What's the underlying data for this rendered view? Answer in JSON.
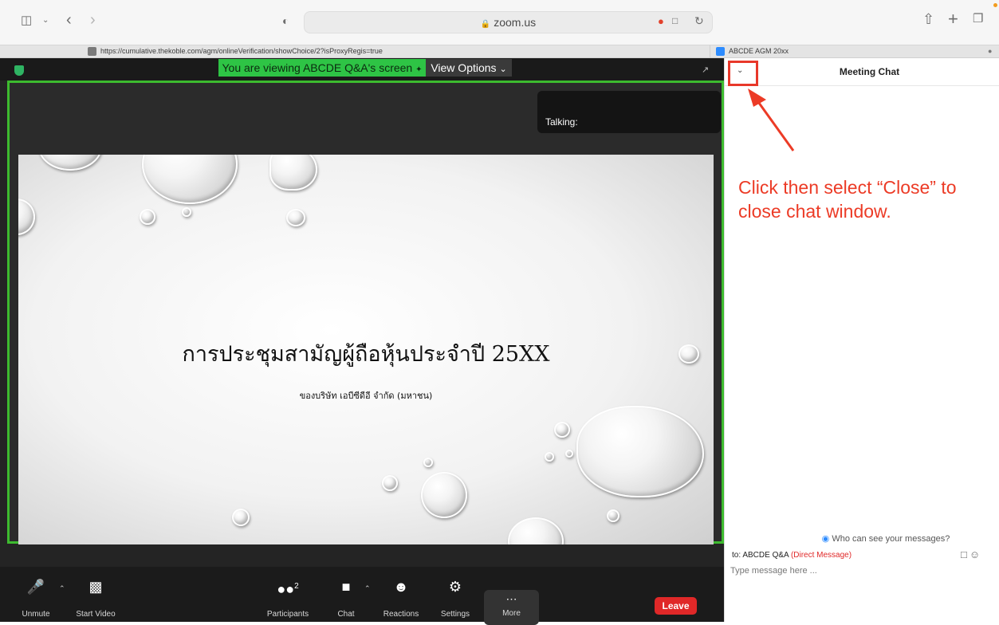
{
  "browser": {
    "domain": "zoom.us",
    "tab_left_url": "https://cumulative.thekoble.com/agm/onlineVerification/showChoice/2?isProxyRegis=true",
    "tab_right_title": "ABCDE AGM 20xx"
  },
  "meeting": {
    "share_banner": "You are viewing ABCDE Q&A's screen",
    "view_options_label": "View Options",
    "talking_label": "Talking:",
    "slide_title": "การประชุมสามัญผู้ถือหุ้นประจำปี 25XX",
    "slide_subtitle": "ของบริษัท เอบีซีดีอี จำกัด (มหาชน)"
  },
  "controls": {
    "unmute": "Unmute",
    "start_video": "Start Video",
    "participants": "Participants",
    "participants_count": "2",
    "chat": "Chat",
    "reactions": "Reactions",
    "settings": "Settings",
    "more": "More",
    "leave": "Leave"
  },
  "chat": {
    "title": "Meeting Chat",
    "annotation": "Click then select “Close” to close chat window.",
    "who_can_see": "Who can see your messages?",
    "to_label": "to: ABCDE Q&A",
    "direct_message": "(Direct Message)",
    "input_placeholder": "Type message here ..."
  },
  "colors": {
    "share_green": "#2ec445",
    "frame_green": "#3dbb2f",
    "annotation_red": "#ec3b26",
    "leave_red": "#e02828"
  },
  "icons": [
    "sidebar-icon",
    "chevron-down-icon",
    "back-icon",
    "forward-icon",
    "shield-half-icon",
    "lock-icon",
    "microphone-icon",
    "translate-icon",
    "reload-icon",
    "share-icon",
    "plus-icon",
    "tabs-icon",
    "security-shield-icon",
    "expand-icon",
    "microphone-muted-icon",
    "video-off-icon",
    "participants-icon",
    "chat-bubble-icon",
    "reactions-icon",
    "gear-icon",
    "more-dots-icon",
    "file-icon",
    "emoji-icon"
  ]
}
